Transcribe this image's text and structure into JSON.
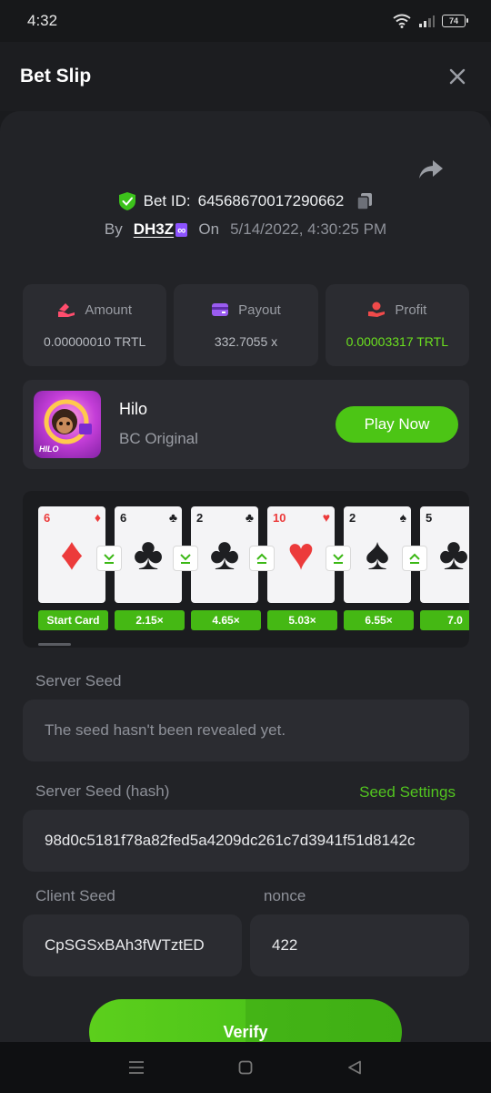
{
  "status_bar": {
    "time": "4:32",
    "battery": "74"
  },
  "header": {
    "title": "Bet Slip"
  },
  "bet": {
    "id_label": "Bet ID:",
    "id_value": "64568670017290662",
    "by_label": "By",
    "user": "DH3Z",
    "user_badge": "∞",
    "on_label": "On",
    "date": "5/14/2022, 4:30:25 PM"
  },
  "stats": {
    "amount": {
      "label": "Amount",
      "value": "0.00000010 TRTL"
    },
    "payout": {
      "label": "Payout",
      "value": "332.7055 x"
    },
    "profit": {
      "label": "Profit",
      "value": "0.00003317 TRTL"
    }
  },
  "game": {
    "thumb_label": "HILO",
    "name": "Hilo",
    "provider": "BC Original",
    "play_label": "Play Now"
  },
  "cards": [
    {
      "rank": "6",
      "suit": "♦",
      "color": "red",
      "multiplier": "Start Card"
    },
    {
      "rank": "6",
      "suit": "♣",
      "color": "black",
      "multiplier": "2.15×"
    },
    {
      "rank": "2",
      "suit": "♣",
      "color": "black",
      "multiplier": "4.65×"
    },
    {
      "rank": "10",
      "suit": "♥",
      "color": "red",
      "multiplier": "5.03×"
    },
    {
      "rank": "2",
      "suit": "♠",
      "color": "black",
      "multiplier": "6.55×"
    },
    {
      "rank": "5",
      "suit": "♣",
      "color": "black",
      "multiplier": "7.0"
    }
  ],
  "predictions": [
    "lower",
    "lower",
    "higher",
    "lower",
    "higher"
  ],
  "server_seed": {
    "label": "Server Seed",
    "placeholder": "The seed hasn't been revealed yet."
  },
  "server_seed_hash": {
    "label": "Server Seed (hash)",
    "value": "98d0c5181f78a82fed5a4209dc261c7d3941f51d8142c",
    "settings_link": "Seed Settings"
  },
  "client_seed": {
    "label": "Client Seed",
    "value": "CpSGSxBAh3fWTztED"
  },
  "nonce": {
    "label": "nonce",
    "value": "422"
  },
  "verify_label": "Verify",
  "colors": {
    "accent_green": "#4cc515",
    "background": "#1a1b1e",
    "panel": "#2b2c31"
  }
}
